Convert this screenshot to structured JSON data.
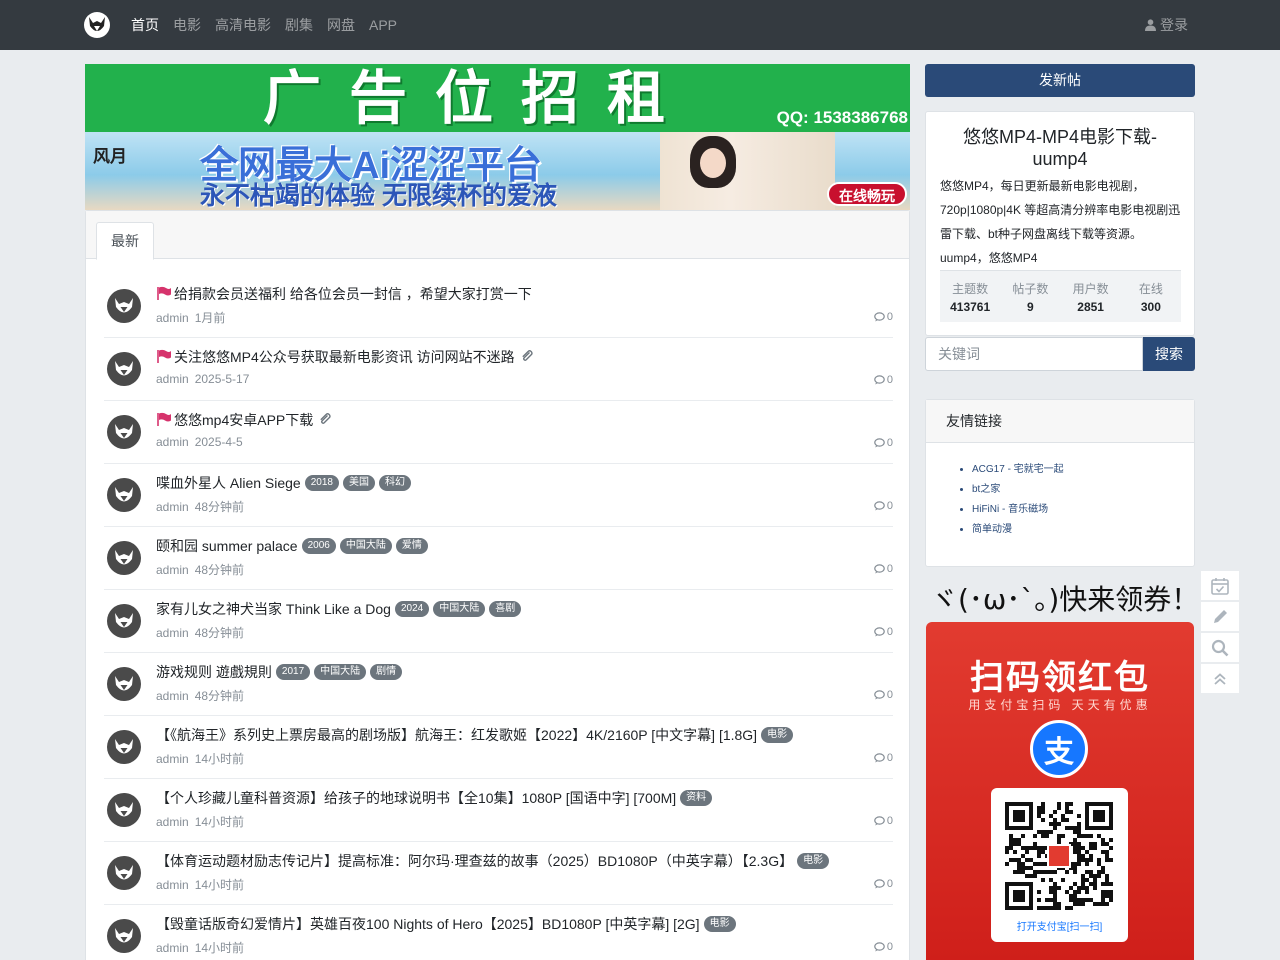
{
  "nav": {
    "links": [
      "首页",
      "电影",
      "高清电影",
      "剧集",
      "网盘",
      "APP"
    ],
    "login": "登录"
  },
  "ads": {
    "banner1_title": "广告位招租",
    "banner1_qq": "QQ: 1538386768",
    "banner2_logo": "风月",
    "banner2_line1": "全网最大Ai涩涩平台",
    "banner2_line2": "永不枯竭的体验 无限续杯的爱液",
    "banner2_button": "在线畅玩"
  },
  "tabs": {
    "latest": "最新"
  },
  "threads": [
    {
      "title": "给捐款会员送福利 给各位会员一封信 ，希望大家打赏一下",
      "author": "admin",
      "date": "1月前",
      "replies": "0",
      "sticky": true,
      "attach": false,
      "badges": []
    },
    {
      "title": "关注悠悠MP4公众号获取最新电影资讯 访问网站不迷路",
      "author": "admin",
      "date": "2025-5-17",
      "replies": "0",
      "sticky": true,
      "attach": true,
      "badges": []
    },
    {
      "title": "悠悠mp4安卓APP下载",
      "author": "admin",
      "date": "2025-4-5",
      "replies": "0",
      "sticky": true,
      "attach": true,
      "badges": []
    },
    {
      "title": "喋血外星人 Alien Siege",
      "author": "admin",
      "date": "48分钟前",
      "replies": "0",
      "sticky": false,
      "attach": false,
      "badges": [
        "2018",
        "美国",
        "科幻"
      ]
    },
    {
      "title": "颐和园 summer palace",
      "author": "admin",
      "date": "48分钟前",
      "replies": "0",
      "sticky": false,
      "attach": false,
      "badges": [
        "2006",
        "中国大陆",
        "爱情"
      ]
    },
    {
      "title": "家有儿女之神犬当家 Think Like a Dog",
      "author": "admin",
      "date": "48分钟前",
      "replies": "0",
      "sticky": false,
      "attach": false,
      "badges": [
        "2024",
        "中国大陆",
        "喜剧"
      ]
    },
    {
      "title": "游戏规则 遊戲規則",
      "author": "admin",
      "date": "48分钟前",
      "replies": "0",
      "sticky": false,
      "attach": false,
      "badges": [
        "2017",
        "中国大陆",
        "剧情"
      ]
    },
    {
      "title": "【《航海王》系列史上票房最高的剧场版】航海王：红发歌姬【2022】4K/2160P [中文字幕] [1.8G]",
      "author": "admin",
      "date": "14小时前",
      "replies": "0",
      "sticky": false,
      "attach": false,
      "badges": [
        "电影"
      ]
    },
    {
      "title": "【个人珍藏儿童科普资源】给孩子的地球说明书【全10集】1080P [国语中字] [700M]",
      "author": "admin",
      "date": "14小时前",
      "replies": "0",
      "sticky": false,
      "attach": false,
      "badges": [
        "资料"
      ]
    },
    {
      "title": "【体育运动题材励志传记片】提高标准：阿尔玛·理查兹的故事（2025）BD1080P（中英字幕）【2.3G】",
      "author": "admin",
      "date": "14小时前",
      "replies": "0",
      "sticky": false,
      "attach": false,
      "badges": [
        "电影"
      ]
    },
    {
      "title": "【毁童话版奇幻爱情片】英雄百夜100 Nights of Hero【2025】BD1080P [中英字幕] [2G]",
      "author": "admin",
      "date": "14小时前",
      "replies": "0",
      "sticky": false,
      "attach": false,
      "badges": [
        "电影"
      ]
    }
  ],
  "sidebar": {
    "new_post": "发新帖",
    "site_title": "悠悠MP4-MP4电影下载-uump4",
    "site_desc": "悠悠MP4，每日更新最新电影电视剧，720p|1080p|4K 等超高清分辨率电影电视剧迅雷下载、bt种子网盘离线下载等资源。uump4，悠悠MP4",
    "stats": [
      {
        "label": "主题数",
        "value": "413761"
      },
      {
        "label": "帖子数",
        "value": "9"
      },
      {
        "label": "用户数",
        "value": "2851"
      },
      {
        "label": "在线",
        "value": "300"
      }
    ],
    "search_placeholder": "关键词",
    "search_button": "搜索",
    "links_title": "友情链接",
    "links": [
      "ACG17 - 宅就宅一起",
      "bt之家",
      "HiFiNi - 音乐磁场",
      "简单动漫"
    ],
    "kaomoji": "ヾ(･ω･`｡)快来领券！",
    "redpack_title": "扫码领红包",
    "redpack_sub": "用支付宝扫码 天天有优惠",
    "redpack_logo": "支",
    "redpack_qr_text": "打开支付宝[扫一扫]"
  },
  "colors": {
    "navbar": "#343a40",
    "primary": "#2a4a78",
    "badge": "#6c757d",
    "sticky_flag": "#d6336c"
  }
}
